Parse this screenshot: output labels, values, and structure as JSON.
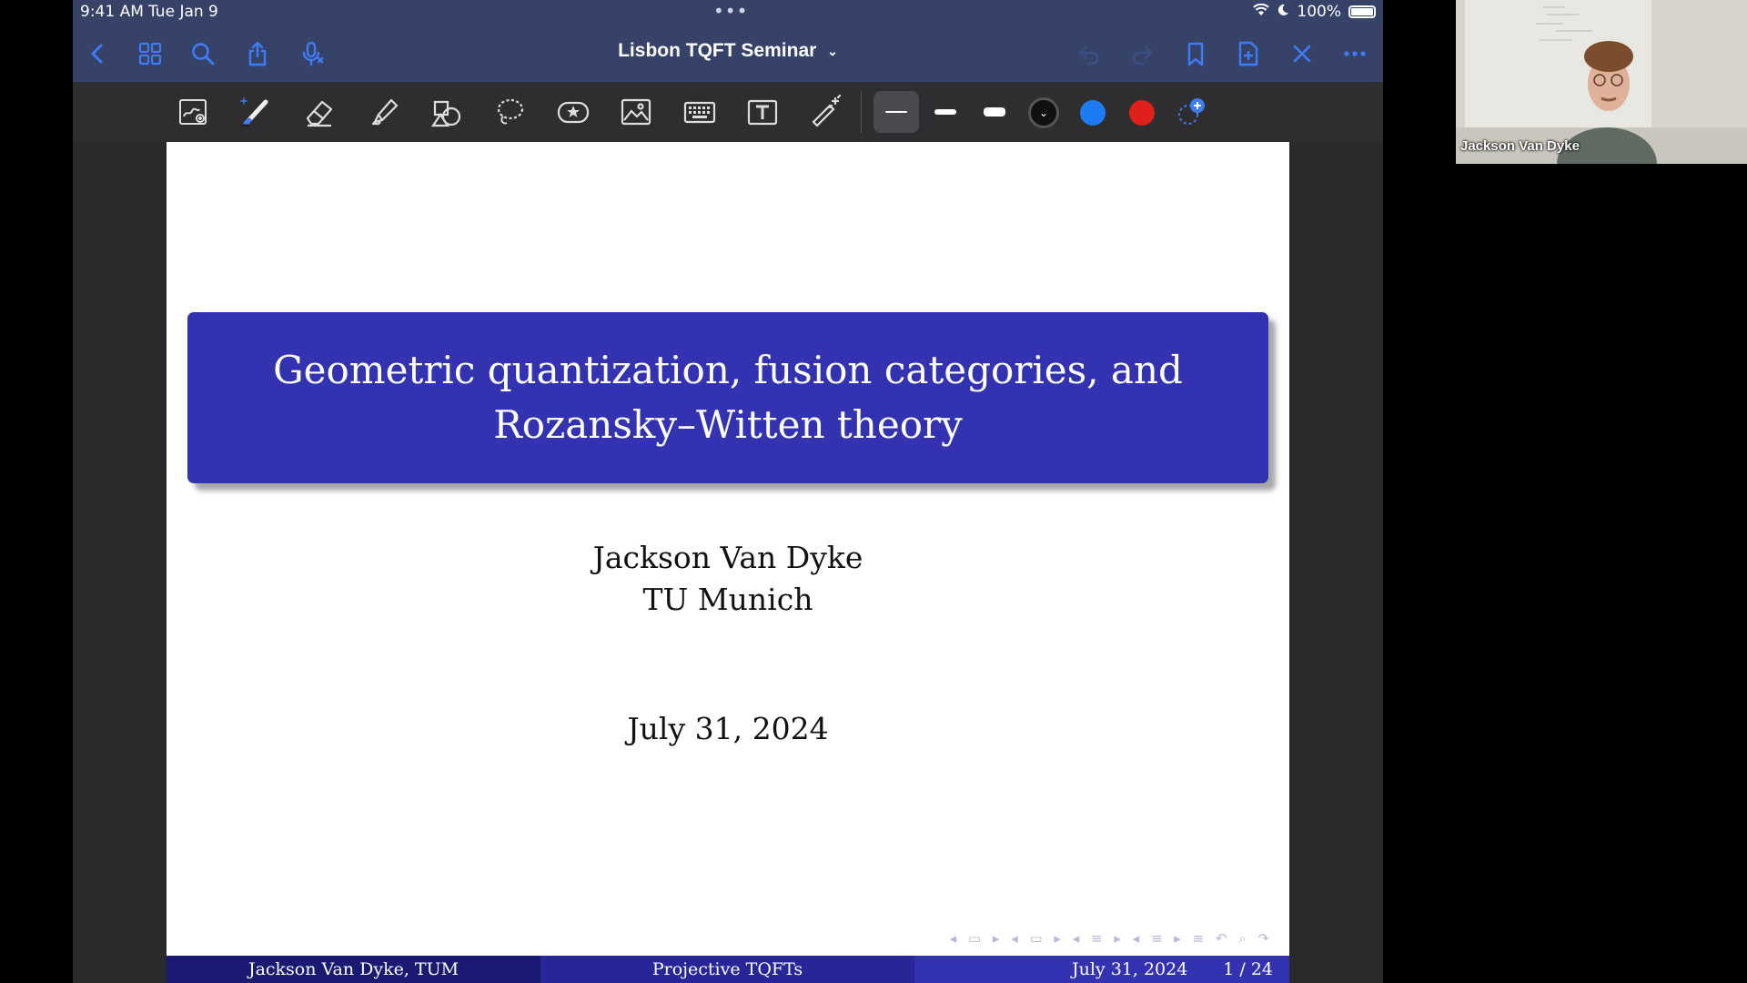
{
  "status_bar": {
    "time": "9:41 AM",
    "date": "Tue Jan 9",
    "battery": "100%"
  },
  "nav": {
    "title": "Lisbon TQFT Seminar",
    "icons": [
      "back-icon",
      "thumbnail-grid-icon",
      "search-icon",
      "share-icon",
      "microphone-icon",
      "undo-icon",
      "redo-icon",
      "bookmark-icon",
      "add-page-icon",
      "close-icon",
      "more-icon"
    ]
  },
  "toolbar": {
    "tools": [
      "scan-document-icon",
      "pen-icon",
      "eraser-icon",
      "highlighter-icon",
      "shapes-icon",
      "lasso-icon",
      "sticker-icon",
      "image-icon",
      "keyboard-icon",
      "text-box-icon",
      "laser-pointer-icon"
    ],
    "stroke_widths": [
      "thin",
      "medium",
      "thick"
    ],
    "colors": [
      "#111111",
      "#1e7cf2",
      "#e0211b"
    ]
  },
  "slide": {
    "title_line1": "Geometric quantization, fusion categories, and",
    "title_line2": "Rozansky–Witten theory",
    "author": "Jackson Van Dyke",
    "affiliation": "TU Munich",
    "date": "July 31, 2024",
    "footer": {
      "author": "Jackson Van Dyke, TUM",
      "short_title": "Projective TQFTs",
      "date": "July 31, 2024",
      "page": "1 / 24"
    }
  },
  "video": {
    "participant_name": "Jackson Van Dyke"
  }
}
